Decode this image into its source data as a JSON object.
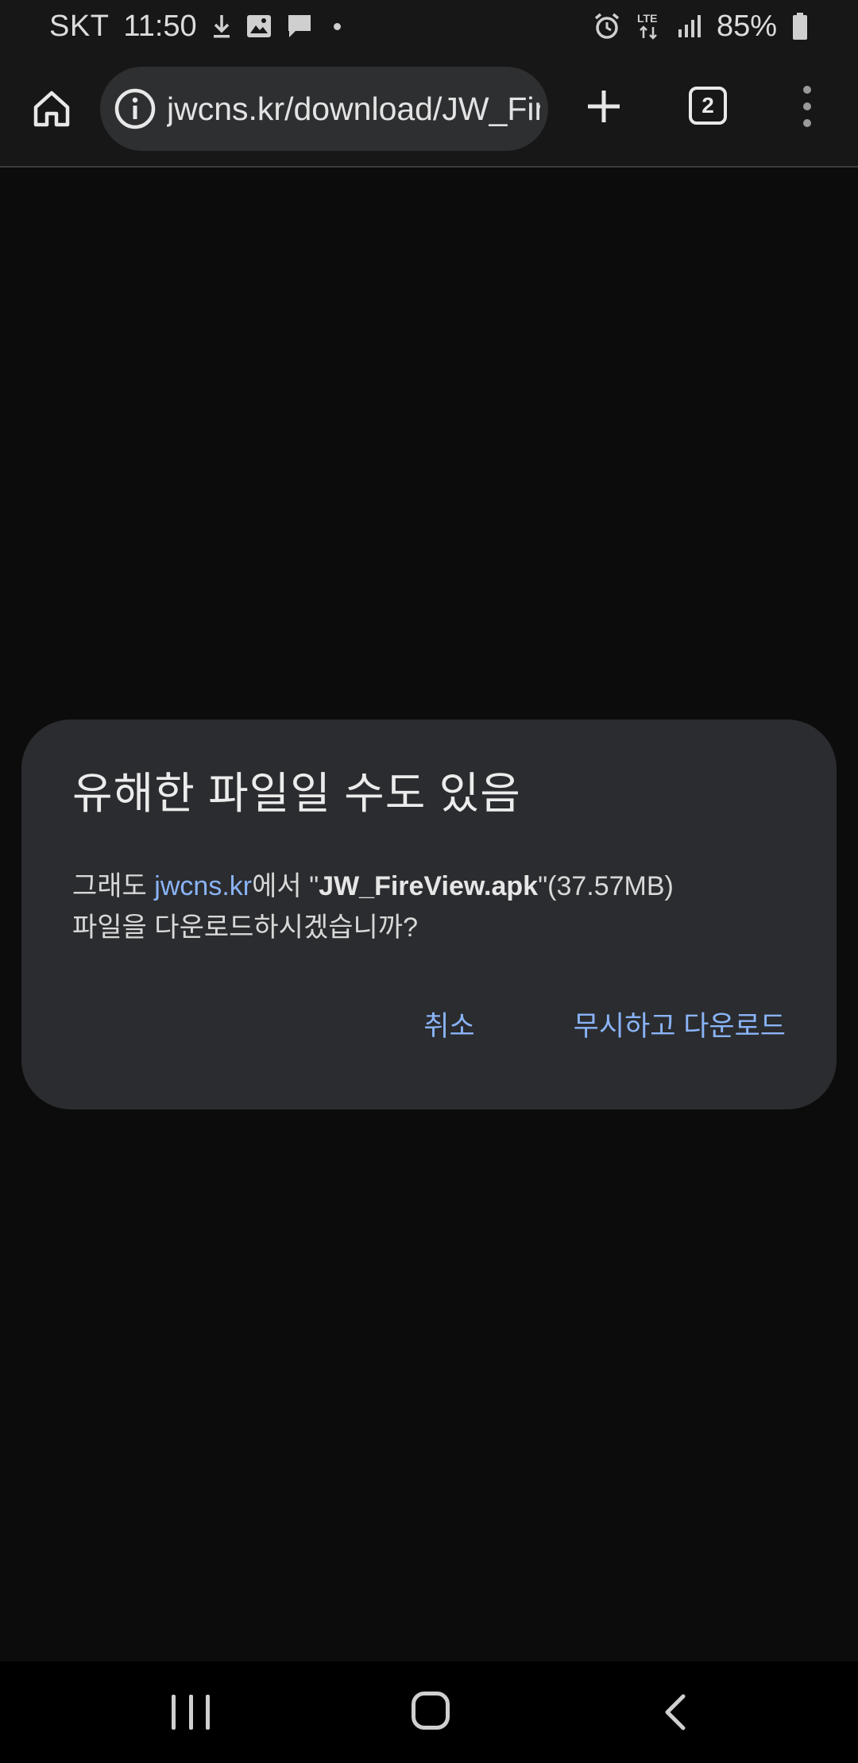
{
  "status_bar": {
    "carrier": "SKT",
    "time": "11:50",
    "network": "LTE",
    "battery": "85%",
    "icons": [
      "download-icon",
      "image-icon",
      "message-icon",
      "dot-icon",
      "alarm-icon",
      "lte-icon",
      "signal-icon",
      "battery-icon"
    ]
  },
  "toolbar": {
    "url": "jwcns.kr/download/JW_FireView.apk",
    "tab_count": "2",
    "icons": [
      "home-icon",
      "info-icon",
      "plus-icon",
      "tabs-icon",
      "more-vert-icon"
    ]
  },
  "dialog": {
    "title": "유해한 파일일 수도 있음",
    "body_prefix": "그래도 ",
    "body_link": "jwcns.kr",
    "body_middle": "에서 \"",
    "body_file": "JW_FireView.apk",
    "body_suffix": "\"(37.57MB)",
    "body_line2": "파일을 다운로드하시겠습니까?",
    "cancel_label": "취소",
    "confirm_label": "무시하고 다운로드"
  },
  "nav_bar": {
    "icons": [
      "recent-apps-icon",
      "home-nav-icon",
      "back-icon"
    ]
  },
  "colors": {
    "background": "#0c0c0c",
    "toolbar": "#171717",
    "dialog": "#2b2c2f",
    "accent": "#8ab4f8"
  }
}
